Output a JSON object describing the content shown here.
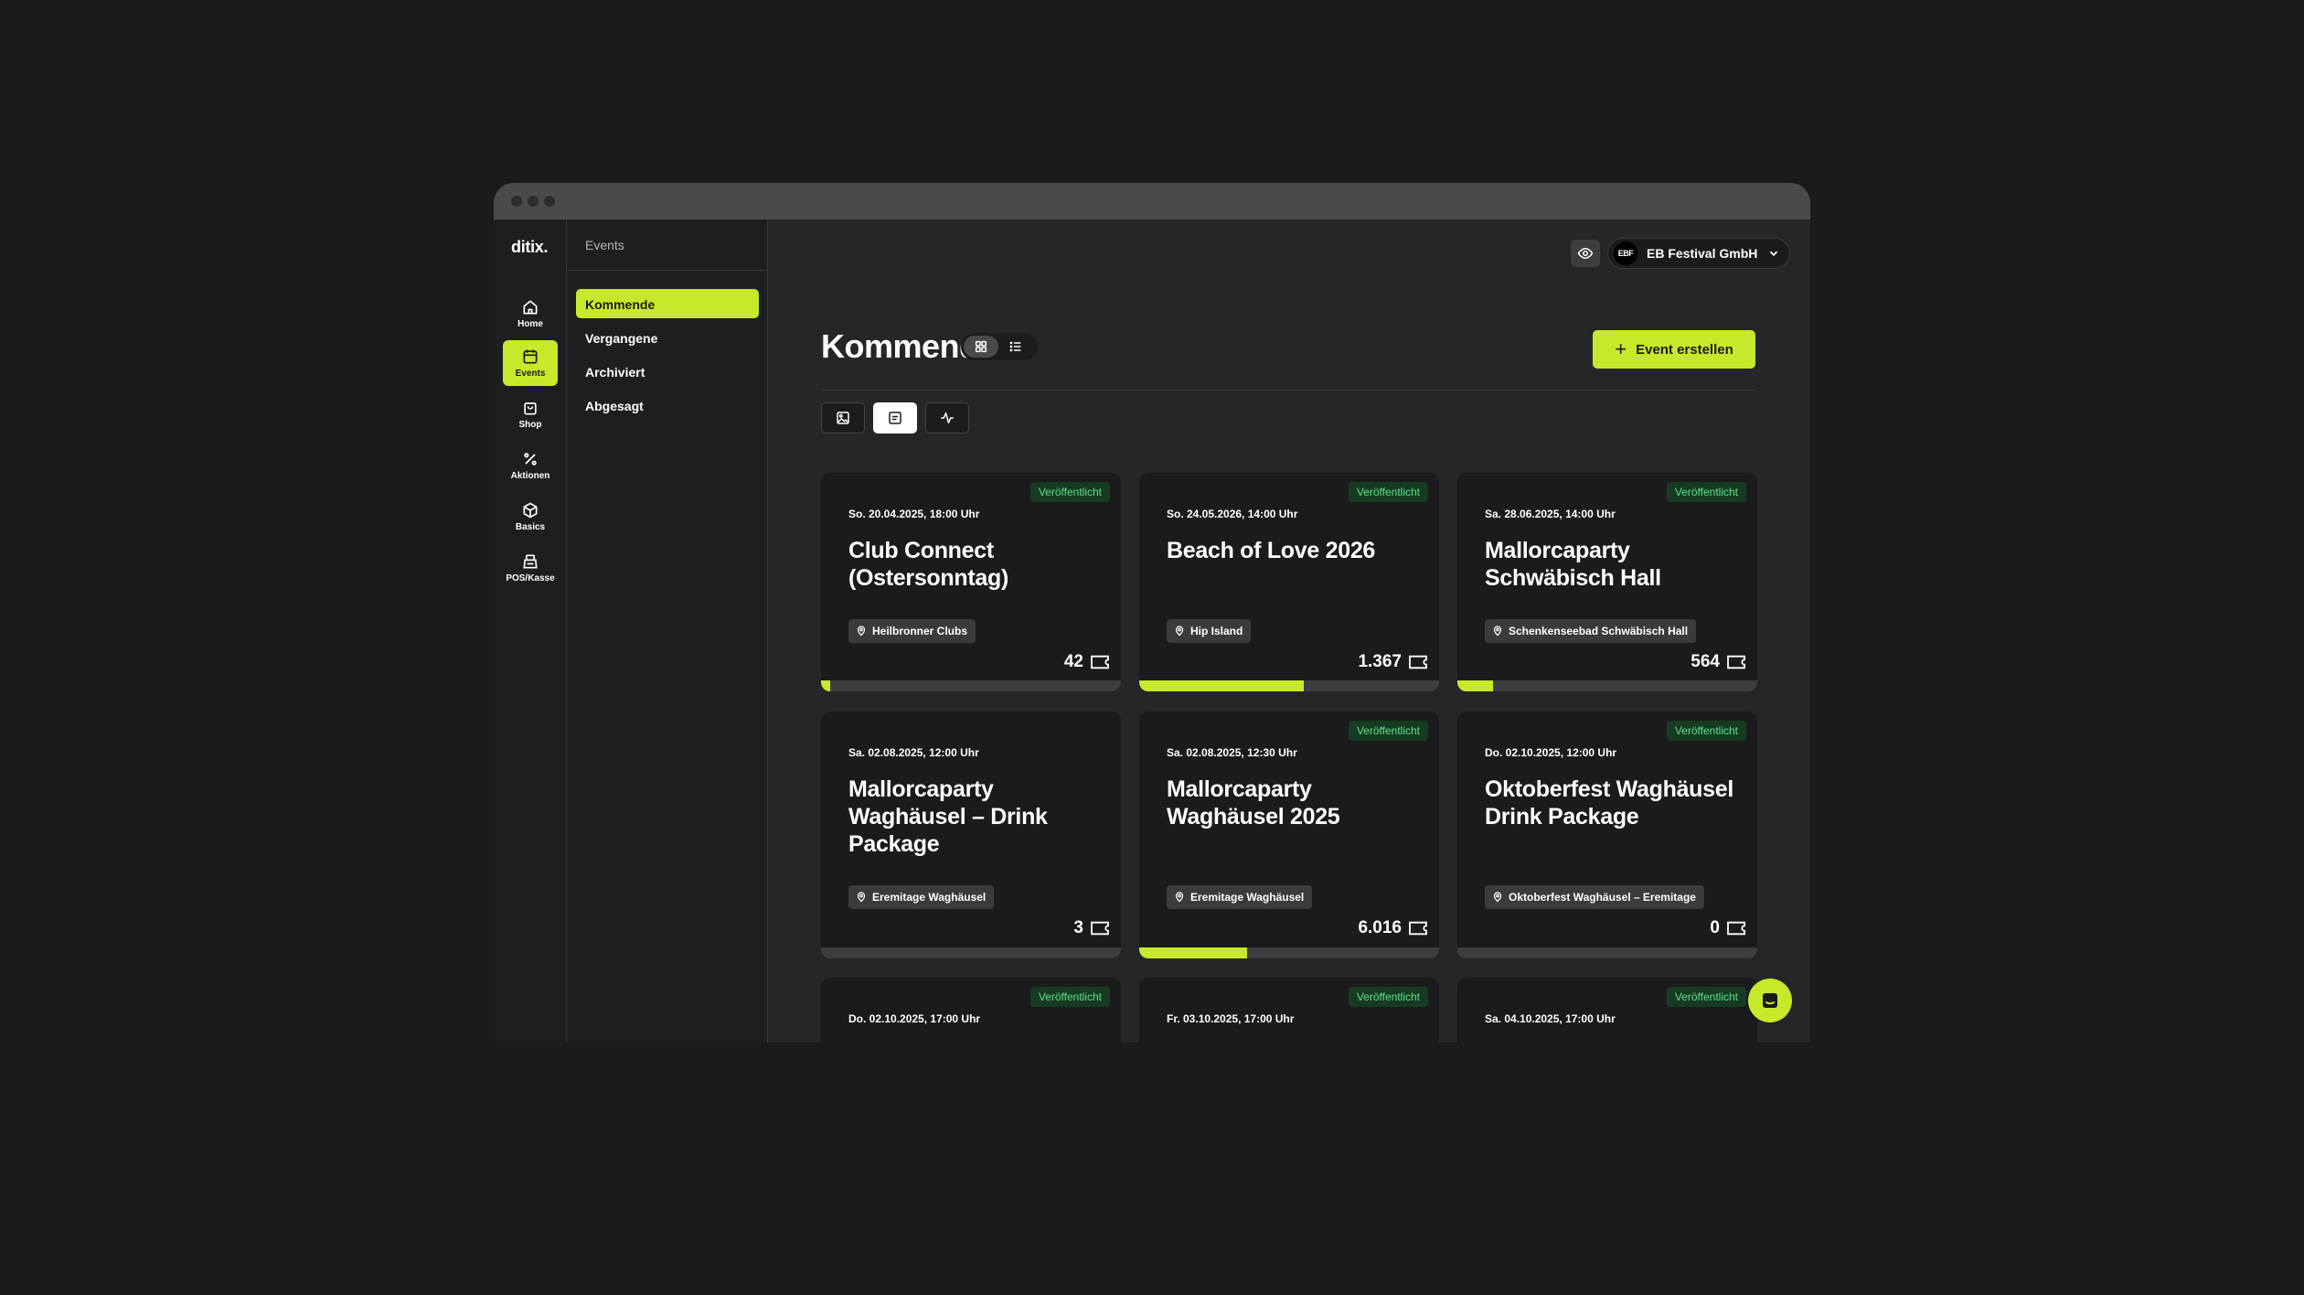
{
  "app": {
    "logo": "ditix.",
    "accent": "#c6ea2b",
    "published_color": "#5fe08a"
  },
  "rail": [
    {
      "label": "Home",
      "icon": "home-icon"
    },
    {
      "label": "Events",
      "icon": "calendar-icon",
      "active": true
    },
    {
      "label": "Shop",
      "icon": "shopping-bag-icon"
    },
    {
      "label": "Aktionen",
      "icon": "percent-icon"
    },
    {
      "label": "Basics",
      "icon": "box-icon"
    },
    {
      "label": "POS/Kasse",
      "icon": "cash-register-icon"
    }
  ],
  "subnav": {
    "title": "Events",
    "items": [
      {
        "label": "Kommende",
        "active": true
      },
      {
        "label": "Vergangene"
      },
      {
        "label": "Archiviert"
      },
      {
        "label": "Abgesagt"
      }
    ]
  },
  "header": {
    "org_logo": "EBF",
    "org_name": "EB Festival GmbH"
  },
  "main": {
    "title": "Kommende",
    "create_label": "Event erstellen"
  },
  "events": [
    {
      "status": "Veröffentlicht",
      "date": "So. 20.04.2025, 18:00 Uhr",
      "title": "Club Connect (Ostersonntag)",
      "location": "Heilbronner Clubs",
      "count": "42",
      "progress": 0.03
    },
    {
      "status": "Veröffentlicht",
      "date": "So. 24.05.2026, 14:00 Uhr",
      "title": "Beach of Love 2026",
      "location": "Hip Island",
      "count": "1.367",
      "progress": 0.55
    },
    {
      "status": "Veröffentlicht",
      "date": "Sa. 28.06.2025, 14:00 Uhr",
      "title": "Mallorcaparty Schwäbisch Hall",
      "location": "Schenkenseebad Schwäbisch Hall",
      "count": "564",
      "progress": 0.12
    },
    {
      "status": "",
      "date": "Sa. 02.08.2025, 12:00 Uhr",
      "title": "Mallorcaparty Waghäusel – Drink Package",
      "location": "Eremitage Waghäusel",
      "count": "3",
      "progress": 0
    },
    {
      "status": "Veröffentlicht",
      "date": "Sa. 02.08.2025, 12:30 Uhr",
      "title": "Mallorcaparty Waghäusel 2025",
      "location": "Eremitage Waghäusel",
      "count": "6.016",
      "progress": 0.36
    },
    {
      "status": "Veröffentlicht",
      "date": "Do. 02.10.2025, 12:00 Uhr",
      "title": "Oktoberfest Waghäusel Drink Package",
      "location": "Oktoberfest Waghäusel – Eremitage",
      "count": "0",
      "progress": 0
    },
    {
      "status": "Veröffentlicht",
      "date": "Do. 02.10.2025, 17:00 Uhr",
      "title": "",
      "location": "",
      "count": "",
      "progress": 0
    },
    {
      "status": "Veröffentlicht",
      "date": "Fr. 03.10.2025, 17:00 Uhr",
      "title": "",
      "location": "",
      "count": "",
      "progress": 0
    },
    {
      "status": "Veröffentlicht",
      "date": "Sa. 04.10.2025, 17:00 Uhr",
      "title": "",
      "location": "",
      "count": "",
      "progress": 0
    }
  ]
}
